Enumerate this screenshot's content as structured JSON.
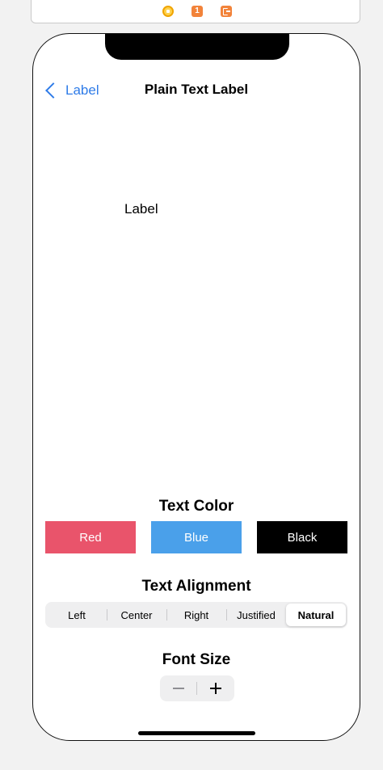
{
  "toolbar": {
    "icons": [
      "view-controller-icon",
      "first-responder-icon",
      "exit-icon"
    ],
    "badge": "1"
  },
  "nav": {
    "back_label": "Label",
    "title": "Plain Text Label"
  },
  "content": {
    "label": "Label"
  },
  "text_color": {
    "title": "Text Color",
    "buttons": [
      {
        "label": "Red",
        "color": "#e9546b"
      },
      {
        "label": "Blue",
        "color": "#4aa0ea"
      },
      {
        "label": "Black",
        "color": "#000000"
      }
    ]
  },
  "text_alignment": {
    "title": "Text Alignment",
    "segments": [
      "Left",
      "Center",
      "Right",
      "Justified",
      "Natural"
    ],
    "selected": "Natural"
  },
  "font_size": {
    "title": "Font Size",
    "decrement_symbol": "minus",
    "increment_symbol": "plus"
  },
  "colors": {
    "accent": "#2f7ce8"
  }
}
